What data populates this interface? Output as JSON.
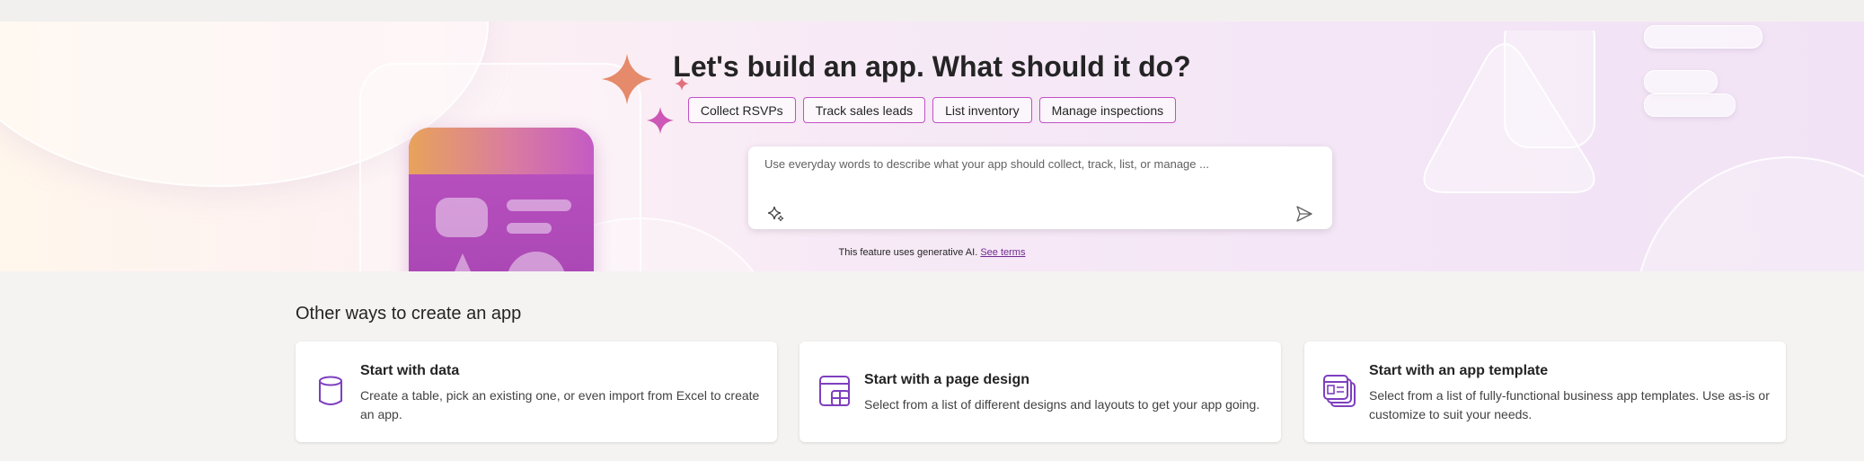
{
  "hero": {
    "title": "Let's build an app. What should it do?",
    "suggestions": [
      "Collect RSVPs",
      "Track sales leads",
      "List inventory",
      "Manage inspections"
    ],
    "prompt_placeholder": "Use everyday words to describe what your app should collect, track, list, or manage ...",
    "disclaimer_text": "This feature uses generative AI.",
    "disclaimer_link": "See terms"
  },
  "other_ways": {
    "title": "Other ways to create an app",
    "cards": [
      {
        "title": "Start with data",
        "description": "Create a table, pick an existing one, or even import from Excel to create an app.",
        "icon": "database-icon"
      },
      {
        "title": "Start with a page design",
        "description": "Select from a list of different designs and layouts to get your app going.",
        "icon": "page-design-icon"
      },
      {
        "title": "Start with an app template",
        "description": "Select from a list of fully-functional business app templates. Use as-is or customize to suit your needs.",
        "icon": "app-template-icon"
      }
    ]
  },
  "colors": {
    "accent": "#c24fc7",
    "link": "#6f2b8f",
    "icon": "#7e3fbf"
  }
}
